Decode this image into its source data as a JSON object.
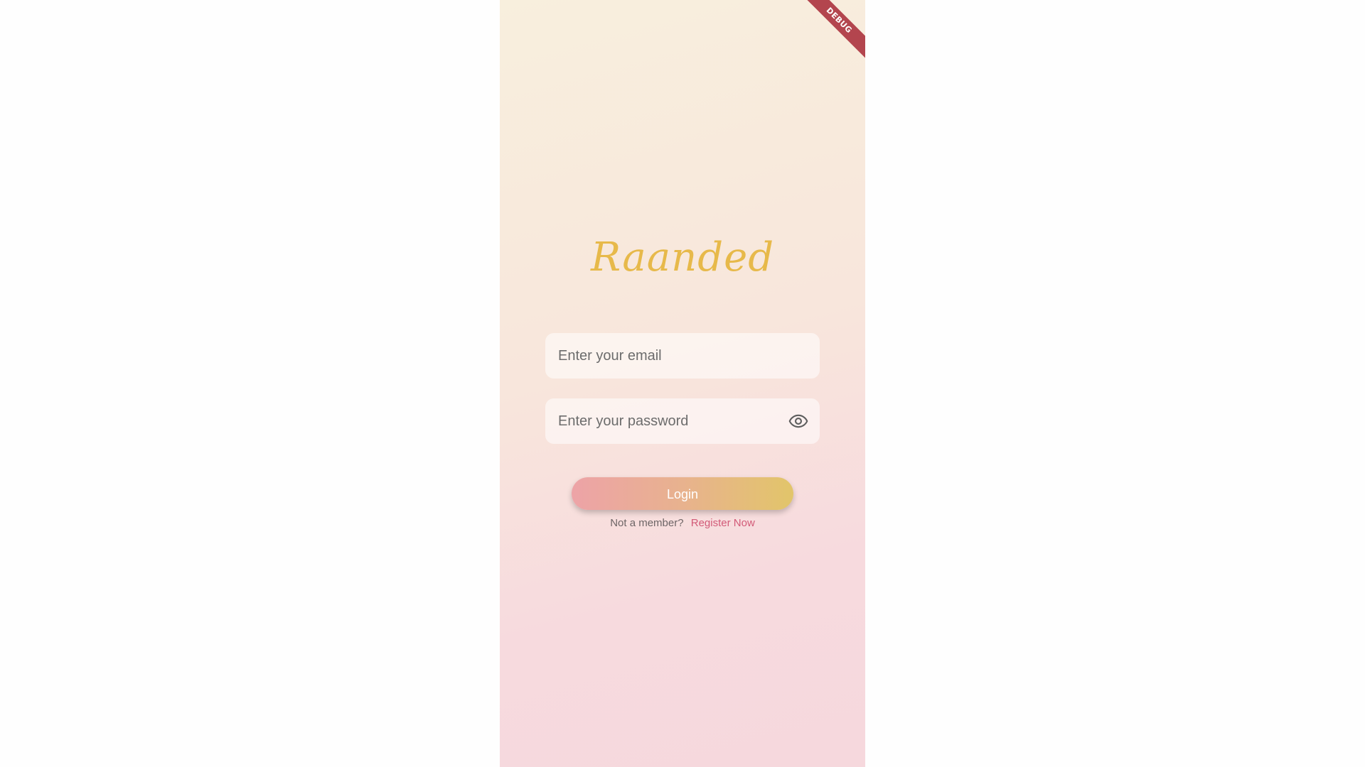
{
  "app": {
    "debug_banner": "DEBUG",
    "logo_text": "Raanded"
  },
  "form": {
    "email": {
      "placeholder": "Enter your email",
      "value": ""
    },
    "password": {
      "placeholder": "Enter your password",
      "value": "",
      "toggle_icon": "eye-icon"
    },
    "login_label": "Login",
    "footer_prompt": "Not a member?",
    "register_link": "Register Now"
  },
  "colors": {
    "logo": "#e7b94a",
    "link": "#d25a78",
    "button_start": "#eda3a7",
    "button_end": "#e2c56a",
    "debug_banner": "#b3454e"
  }
}
